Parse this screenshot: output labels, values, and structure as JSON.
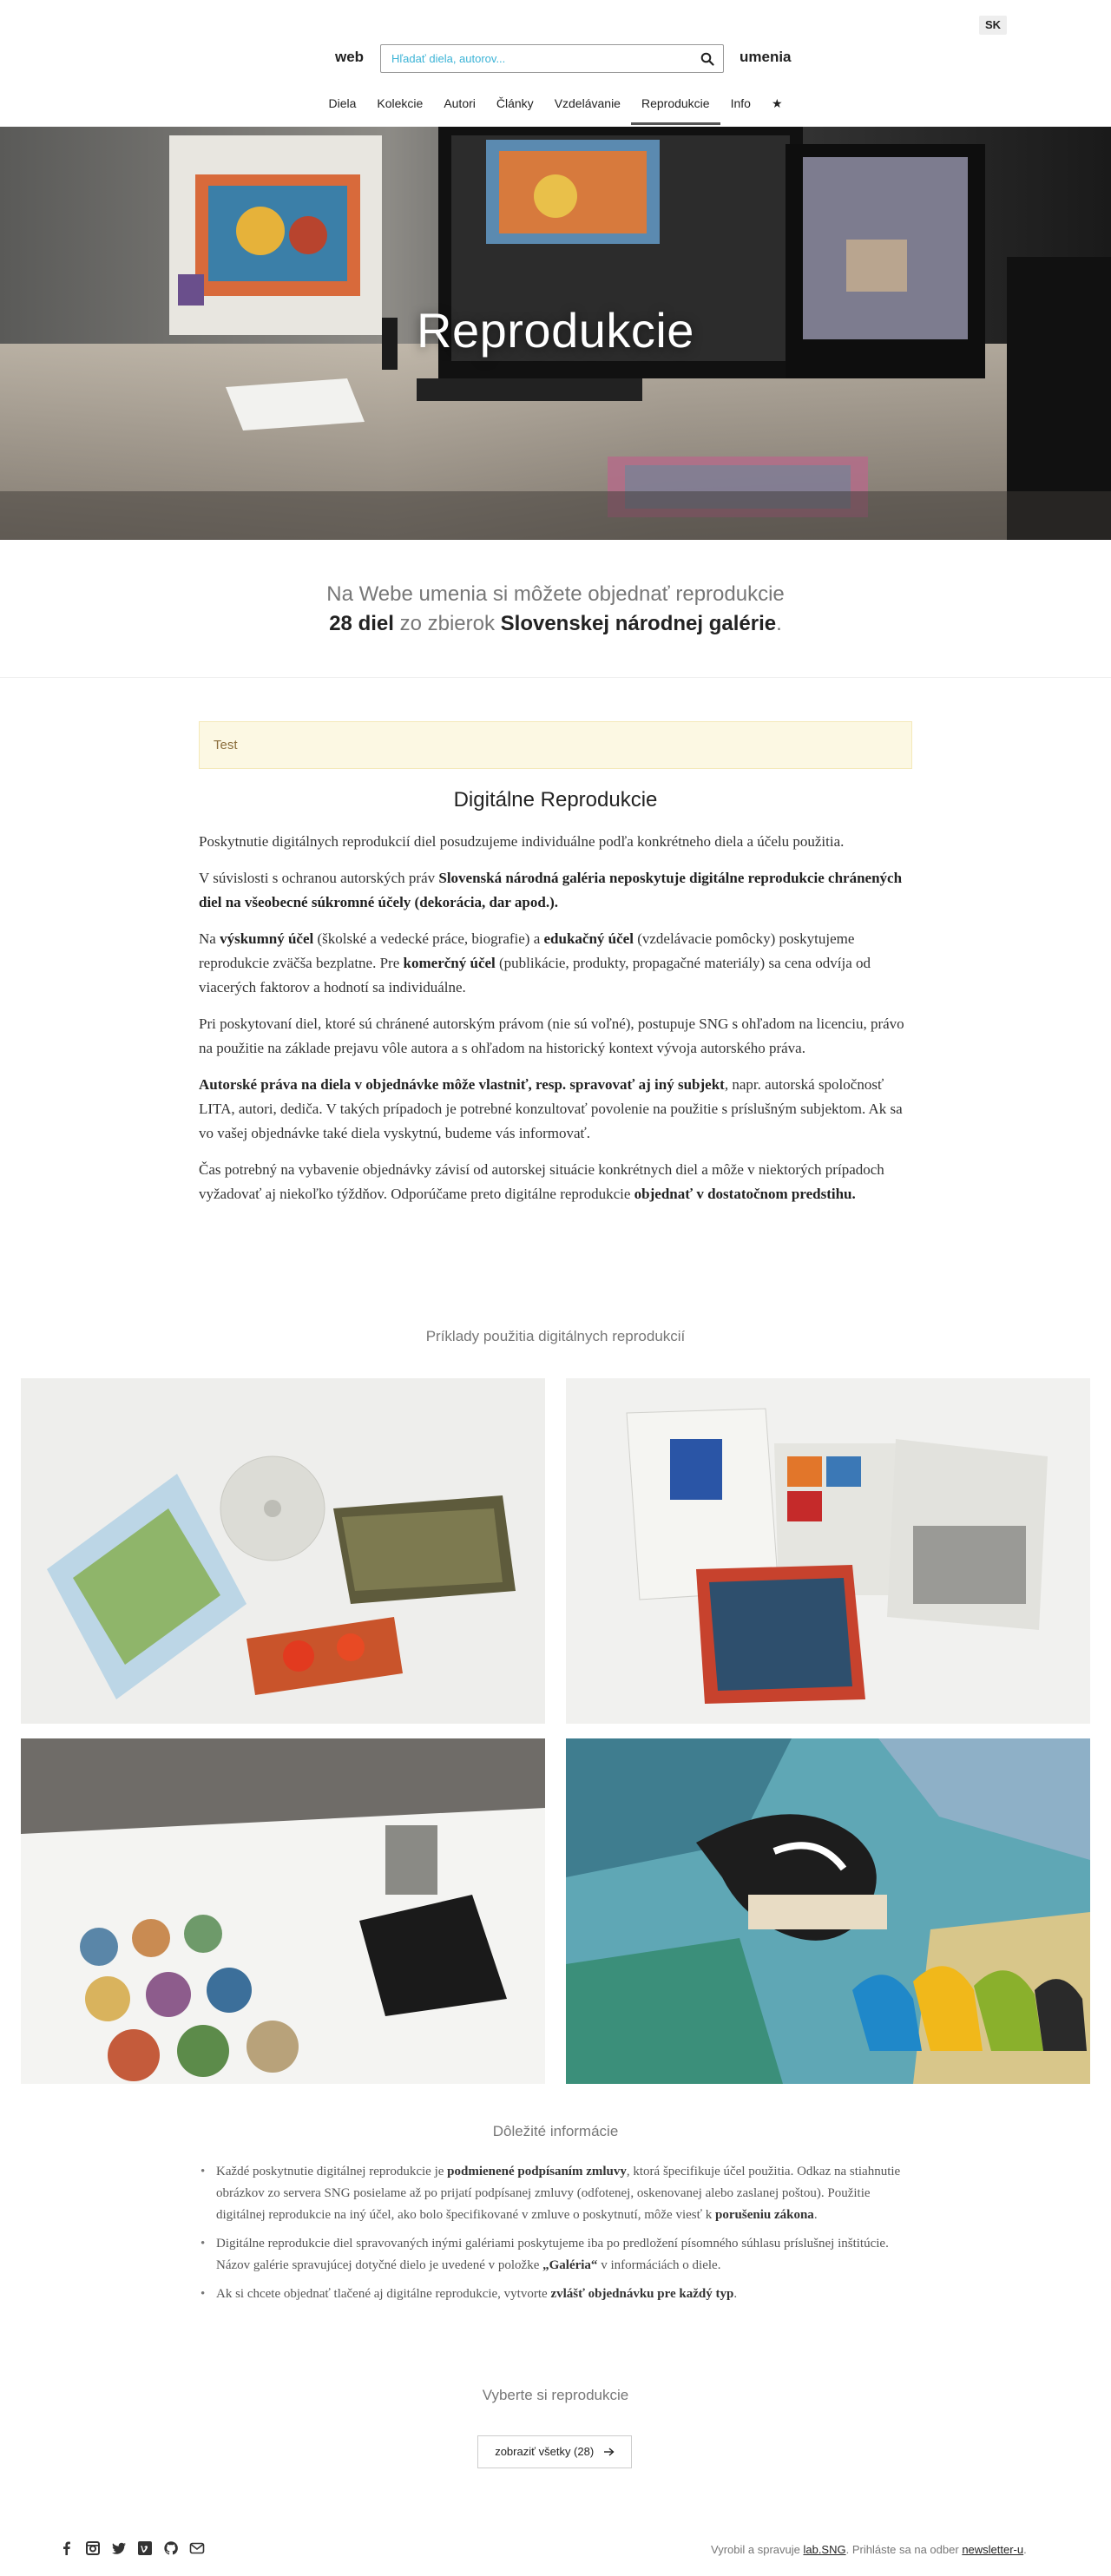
{
  "header": {
    "brand_left": "web",
    "brand_right": "umenia",
    "search_placeholder": "Hľadať diela, autorov...",
    "lang": "SK"
  },
  "nav": {
    "items": [
      {
        "label": "Diela"
      },
      {
        "label": "Kolekcie"
      },
      {
        "label": "Autori"
      },
      {
        "label": "Články"
      },
      {
        "label": "Vzdelávanie"
      },
      {
        "label": "Reprodukcie",
        "active": true
      },
      {
        "label": "Info"
      },
      {
        "label": "★"
      }
    ]
  },
  "hero": {
    "title": "Reprodukcie"
  },
  "intro": {
    "line1": "Na Webe umenia si môžete objednať reprodukcie",
    "count": "28 diel",
    "from": " zo zbierok ",
    "gallery": "Slovenskej národnej galérie",
    "dot": "."
  },
  "alert": {
    "text": "Test"
  },
  "digital": {
    "heading": "Digitálne Reprodukcie",
    "p1": "Poskytnutie digitálnych reprodukcií diel posudzujeme individuálne podľa konkrétneho diela a účelu použitia.",
    "p2a": "V súvislosti s ochranou autorských práv ",
    "p2b": "Slovenská národná galéria neposkytuje digitálne reprodukcie chránených diel na všeobecné súkromné účely (dekorácia, dar apod.).",
    "p3a": "Na ",
    "p3b": "výskumný účel",
    "p3c": " (školské a vedecké práce, biografie) a ",
    "p3d": "edukačný účel",
    "p3e": " (vzdelávacie pomôcky) poskytujeme reprodukcie zväčša bezplatne. Pre ",
    "p3f": "komerčný účel",
    "p3g": " (publikácie, produkty, propagačné materiály) sa cena odvíja od viacerých faktorov a hodnotí sa individuálne.",
    "p4": "Pri poskytovaní diel, ktoré sú chránené autorským právom (nie sú voľné), postupuje SNG s ohľadom na licenciu, právo na použitie na základe prejavu vôle autora a s ohľadom na historický kontext vývoja autorského práva.",
    "p5a": "Autorské práva na diela v objednávke môže vlastniť, resp. spravovať aj iný subjekt",
    "p5b": ", napr. autorská spoločnosť LITA, autori, dediča. V takých prípadoch je potrebné konzultovať povolenie na použitie s príslušným subjektom. Ak sa vo vašej objednávke také diela vyskytnú, budeme vás informovať.",
    "p6a": "Čas potrebný na vybavenie objednávky závisí od autorskej situácie konkrétnych diel a môže v niektorých prípadoch vyžadovať aj niekoľko týždňov. Odporúčame preto digitálne reprodukcie ",
    "p6b": "objednať v dostatočnom predstihu."
  },
  "examples": {
    "heading": "Príklady použitia digitálnych reprodukcií"
  },
  "important": {
    "heading": "Dôležité informácie",
    "i1a": "Každé poskytnutie digitálnej reprodukcie je ",
    "i1b": "podmienené podpísaním zmluvy",
    "i1c": ", ktorá špecifikuje účel použitia. Odkaz na stiahnutie obrázkov zo servera SNG posielame až po prijatí podpísanej zmluvy (odfotenej, oskenovanej alebo zaslanej poštou). Použitie digitálnej reprodukcie na iný účel, ako bolo špecifikované v zmluve o poskytnutí, môže viesť k ",
    "i1d": "porušeniu zákona",
    "i1e": ".",
    "i2a": "Digitálne reprodukcie diel spravovaných inými galériami poskytujeme iba po predložení písomného súhlasu príslušnej inštitúcie. Názov galérie spravujúcej dotyčné dielo je uvedené v položke ",
    "i2b": "„Galéria“",
    "i2c": " v informáciách o diele.",
    "i3a": "Ak si chcete objednať tlačené aj digitálne reprodukcie, vytvorte ",
    "i3b": "zvlášť objednávku pre každý typ",
    "i3c": "."
  },
  "choose": {
    "heading": "Vyberte si reprodukcie",
    "button": "zobraziť všetky (28)",
    "button_icon": "arrow-right-icon"
  },
  "footer": {
    "icons": [
      "facebook-icon",
      "instagram-icon",
      "twitter-icon",
      "vimeo-icon",
      "github-icon",
      "mail-icon"
    ],
    "text1": "Vyrobil a spravuje ",
    "link1": "lab.SNG",
    "text2": ". Prihláste sa na odber ",
    "link2": "newsletter-u",
    "text3": "."
  }
}
